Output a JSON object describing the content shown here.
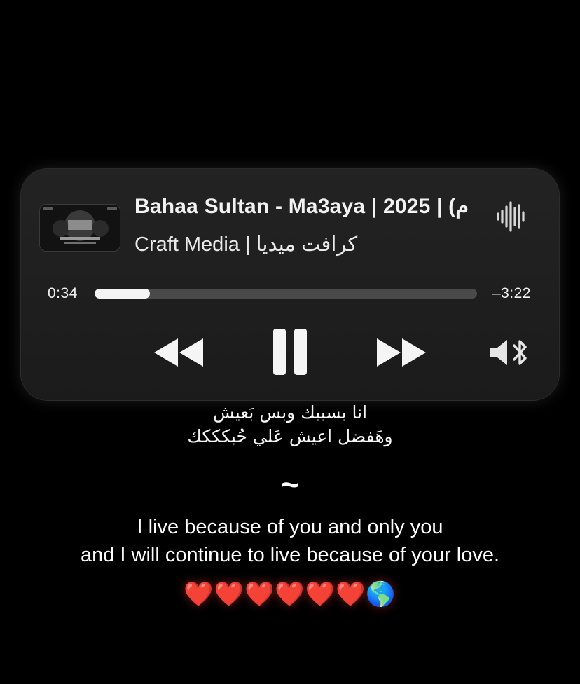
{
  "player": {
    "title": "Bahaa Sultan - Ma3aya | 2025 | (م",
    "artist": "Craft Media | كرافت ميديا",
    "elapsed": "0:34",
    "remaining": "–3:22",
    "progress_fraction": 0.145,
    "artwork_icon": "album-artwork",
    "waveform_icon": "waveform-icon",
    "controls": {
      "rewind_icon": "rewind-icon",
      "pause_icon": "pause-icon",
      "forward_icon": "fast-forward-icon",
      "audio_route_icon": "speaker-bluetooth-icon"
    }
  },
  "lyrics": {
    "arabic_line_1": "انا بسببك وبس بَعيش",
    "arabic_line_2": "وهَفضل اعيش عَلي حُبكككك",
    "separator": "~",
    "english_line_1": "I live because of you and only you",
    "english_line_2": "and I will continue to live because of your love.",
    "emojis": "❤️❤️❤️❤️❤️❤️🌎"
  },
  "colors": {
    "background": "#000000",
    "card": "#1e1e1e",
    "progress_track": "#4a4a4a",
    "progress_fill": "#f4f4f4",
    "text": "#ffffff"
  }
}
